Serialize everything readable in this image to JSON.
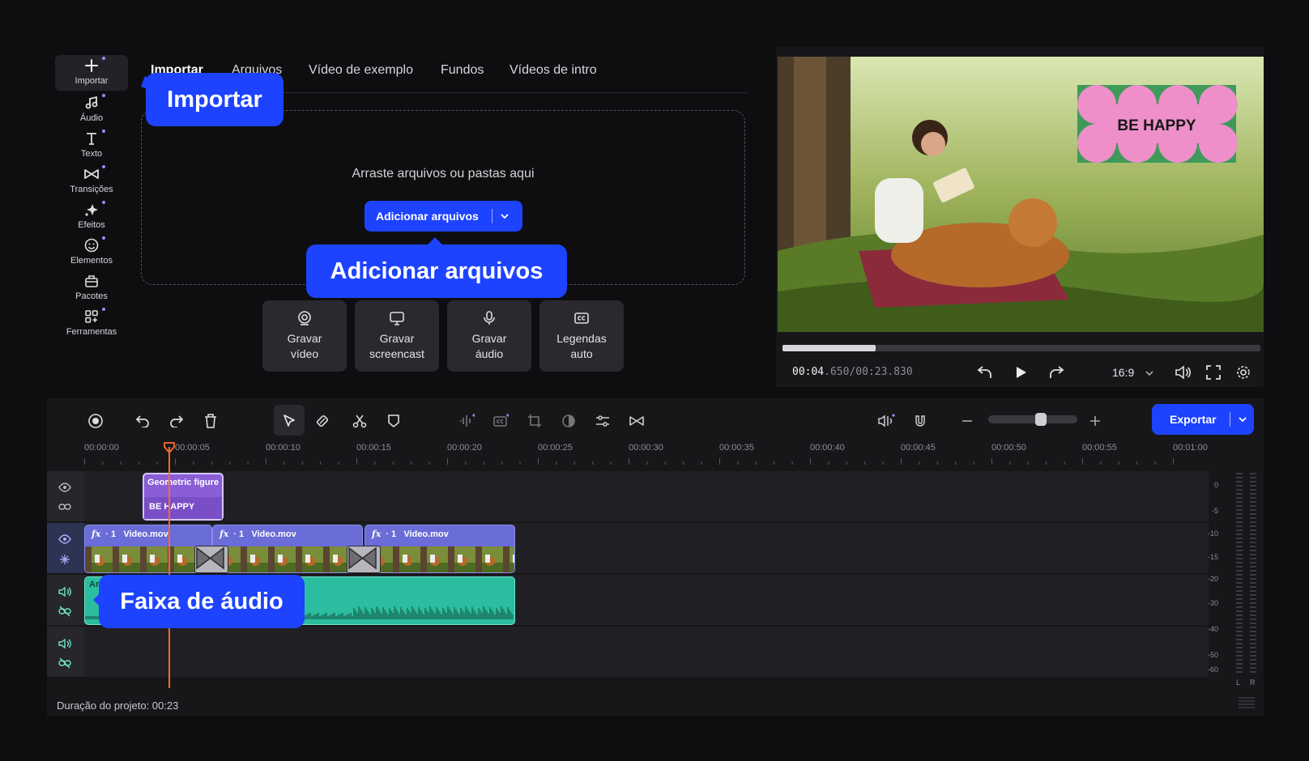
{
  "sidebar": {
    "items": [
      {
        "label": "Importar",
        "icon": "plus-icon"
      },
      {
        "label": "Áudio",
        "icon": "music-note-icon"
      },
      {
        "label": "Texto",
        "icon": "text-icon"
      },
      {
        "label": "Transições",
        "icon": "transition-icon"
      },
      {
        "label": "Efeitos",
        "icon": "sparkle-icon"
      },
      {
        "label": "Elementos",
        "icon": "smiley-icon"
      },
      {
        "label": "Pacotes",
        "icon": "package-icon"
      },
      {
        "label": "Ferramentas",
        "icon": "tools-grid-icon"
      }
    ]
  },
  "tabs": [
    "Importar",
    "Arquivos",
    "Vídeo de exemplo",
    "Fundos",
    "Vídeos de intro"
  ],
  "import_panel": {
    "drop_text": "Arraste arquivos ou pastas aqui",
    "add_files_label": "Adicionar arquivos",
    "record_buttons": [
      {
        "line1": "Gravar",
        "line2": "vídeo",
        "icon": "webcam-icon"
      },
      {
        "line1": "Gravar",
        "line2": "screencast",
        "icon": "monitor-icon"
      },
      {
        "line1": "Gravar",
        "line2": "áudio",
        "icon": "microphone-icon"
      },
      {
        "line1": "Legendas",
        "line2": "auto",
        "icon": "captions-icon"
      }
    ]
  },
  "callouts": {
    "import": "Importar",
    "add_files": "Adicionar arquivos",
    "audio_track": "Faixa de áudio"
  },
  "preview": {
    "overlay_text": "BE HAPPY",
    "time_current": "00:04",
    "time_rest": ".650/00:23.830",
    "progress": 0.195,
    "aspect_ratio": "16:9"
  },
  "timeline": {
    "export_label": "Exportar",
    "zoom_level": 0.6,
    "ruler": [
      "00:00:00",
      "00:00:05",
      "00:00:10",
      "00:00:15",
      "00:00:20",
      "00:00:25",
      "00:00:30",
      "00:00:35",
      "00:00:40",
      "00:00:45",
      "00:00:50",
      "00:00:55",
      "00:01:00"
    ],
    "text_clip": {
      "title": "Geometric figure",
      "text": "BE HAPPY"
    },
    "video_clips": [
      {
        "fx": "fx",
        "count": "· 1",
        "name": "Video.mov"
      },
      {
        "fx": "fx",
        "count": "· 1",
        "name": "Video.mov"
      },
      {
        "fx": "fx",
        "count": "· 1",
        "name": "Video.mov"
      }
    ],
    "audio_clip_label": "Ar",
    "duration_text": "Duração do projeto: 00:23",
    "meter_scale": [
      "0",
      "-5",
      "-10",
      "-15",
      "-20",
      "-30",
      "-40",
      "-50",
      "-60"
    ],
    "meter_channels": [
      "L",
      "R"
    ]
  },
  "colors": {
    "accent": "#1d43ff",
    "video_clip": "#6a6cd7",
    "audio_clip": "#2bbd9f",
    "text_clip": "#8a5ed6",
    "playhead": "#ff6a2b"
  }
}
